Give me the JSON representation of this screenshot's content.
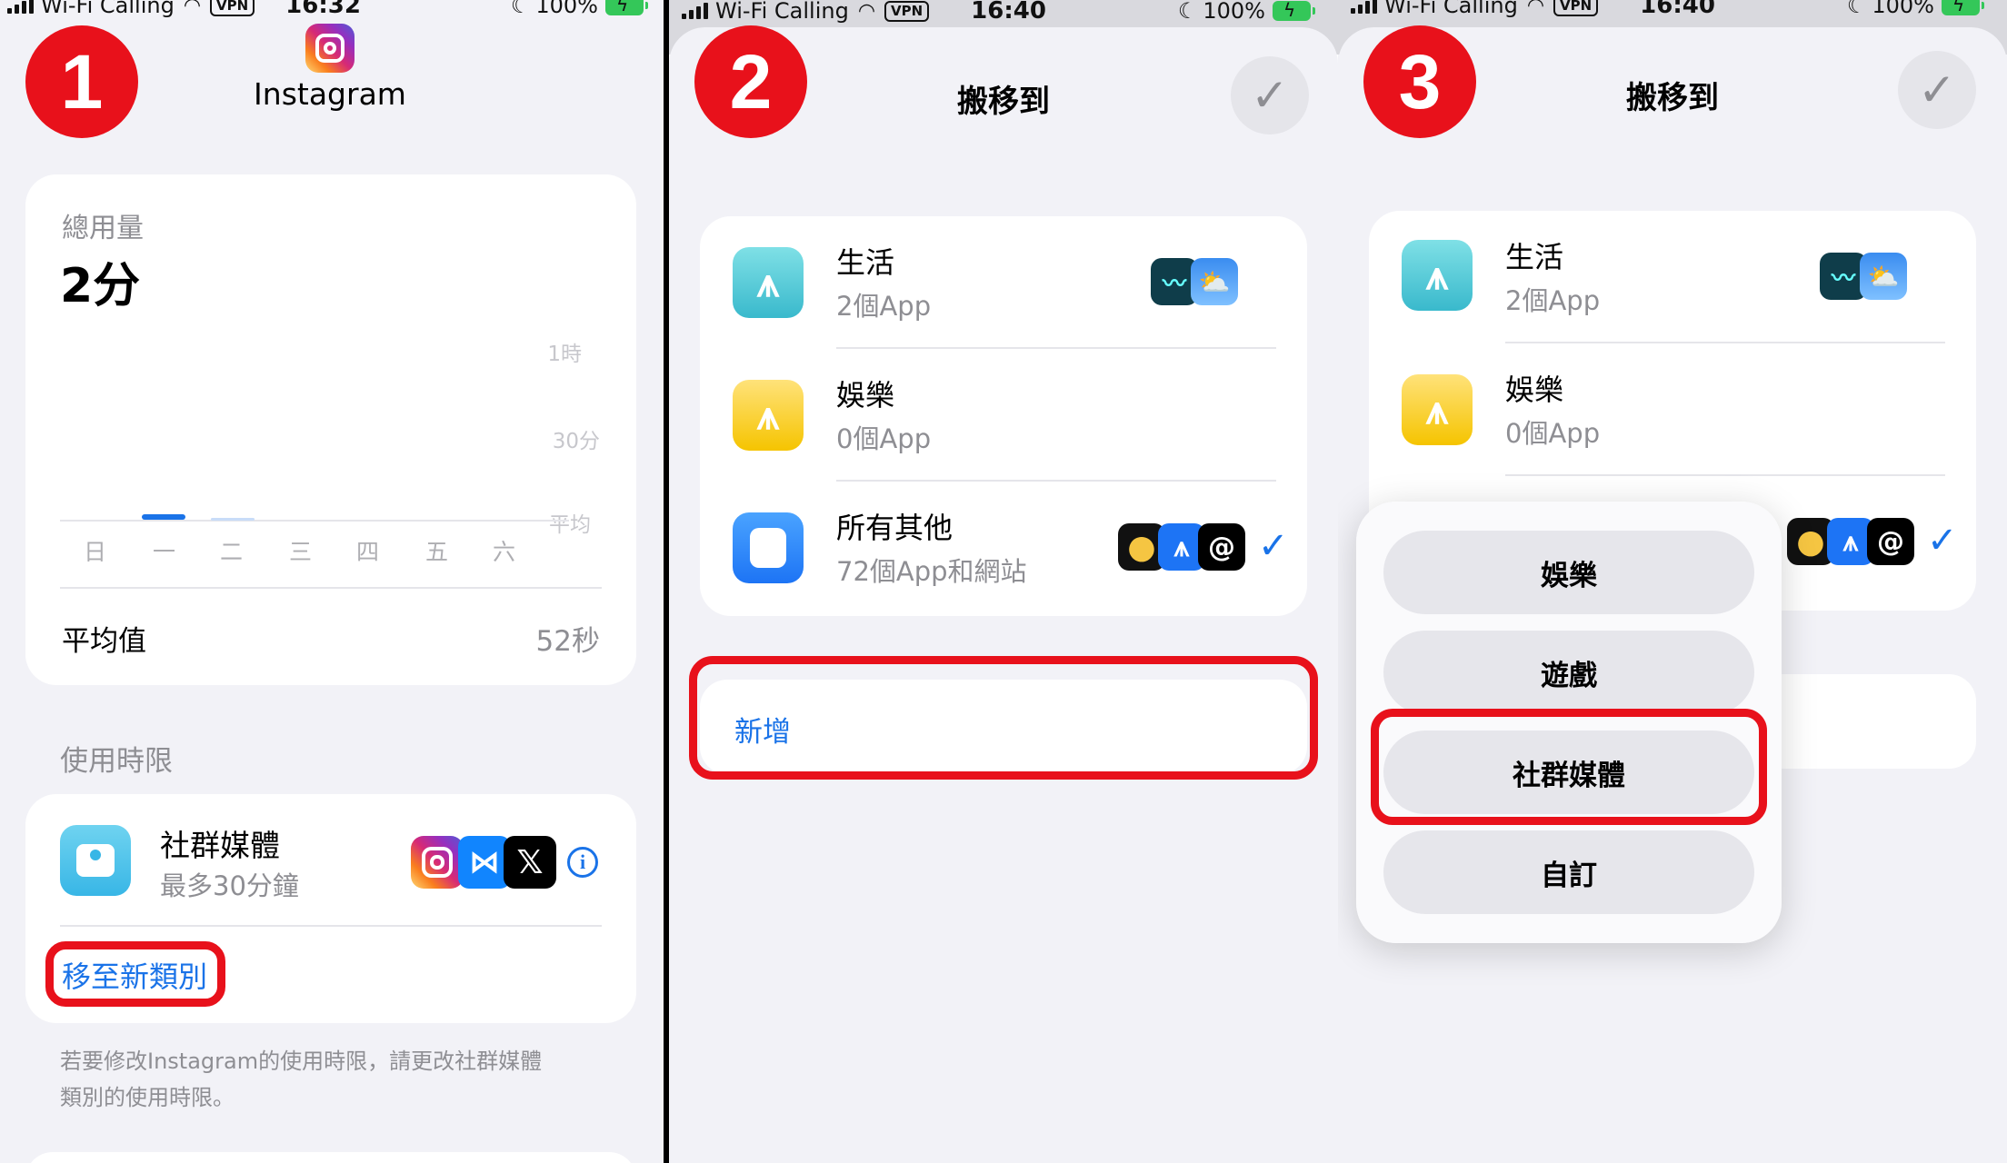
{
  "panel1": {
    "step": "1",
    "status": {
      "carrier": "Wi-Fi Calling",
      "vpn": "VPN",
      "time": "16:32",
      "battery": "100%"
    },
    "app_name": "Instagram",
    "usage": {
      "label": "總用量",
      "value": "2分",
      "axis": [
        "1時",
        "30分",
        "平均"
      ],
      "days": [
        "日",
        "一",
        "二",
        "三",
        "四",
        "五",
        "六"
      ],
      "average_label": "平均值",
      "average_value": "52秒"
    },
    "limits_header": "使用時限",
    "limit": {
      "title": "社群媒體",
      "subtitle": "最多30分鐘",
      "icons": [
        "instagram-icon",
        "butterfly-icon",
        "x-icon"
      ]
    },
    "move_link": "移至新類別",
    "footnote_line1": "若要修改Instagram的使用時限，請更改社群媒體",
    "footnote_line2": "類別的使用時限。"
  },
  "panel2": {
    "step": "2",
    "status": {
      "carrier": "Wi-Fi Calling",
      "vpn": "VPN",
      "time": "16:40",
      "battery": "100%"
    },
    "title": "搬移到",
    "rows": [
      {
        "title": "生活",
        "subtitle": "2個App"
      },
      {
        "title": "娛樂",
        "subtitle": "0個App"
      },
      {
        "title": "所有其他",
        "subtitle": "72個App和網站"
      }
    ],
    "add_label": "新增"
  },
  "panel3": {
    "step": "3",
    "status": {
      "carrier": "Wi-Fi Calling",
      "vpn": "VPN",
      "time": "16:40",
      "battery": "100%"
    },
    "title": "搬移到",
    "rows": [
      {
        "title": "生活",
        "subtitle": "2個App"
      },
      {
        "title": "娛樂",
        "subtitle": "0個App"
      }
    ],
    "menu": [
      "娛樂",
      "遊戲",
      "社群媒體",
      "自訂"
    ]
  },
  "colors": {
    "accent": "#1a73e8",
    "highlight": "#e8111b",
    "background": "#f2f2f7"
  }
}
